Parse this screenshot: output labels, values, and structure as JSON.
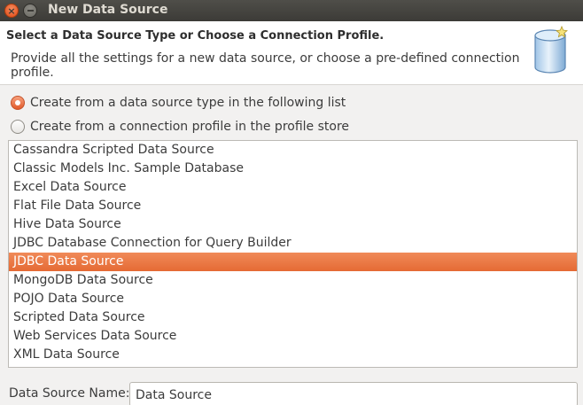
{
  "window": {
    "title": "New Data Source"
  },
  "banner": {
    "heading": "Select a Data Source Type or Choose a Connection Profile.",
    "description": "Provide all the settings for a new data source, or choose a pre-defined connection profile."
  },
  "options": [
    {
      "label": "Create from a data source type in the following list",
      "checked": true
    },
    {
      "label": "Create from a connection profile in the profile store",
      "checked": false
    }
  ],
  "data_source_types": [
    "Cassandra Scripted Data Source",
    "Classic Models Inc. Sample Database",
    "Excel Data Source",
    "Flat File Data Source",
    "Hive Data Source",
    "JDBC Database Connection for Query Builder",
    "JDBC Data Source",
    "MongoDB Data Source",
    "POJO Data Source",
    "Scripted Data Source",
    "Web Services Data Source",
    "XML Data Source"
  ],
  "selected_type": "JDBC Data Source",
  "name_field": {
    "label": "Data Source Name:",
    "value": "Data Source"
  },
  "colors": {
    "accent": "#e5622b",
    "titlebar": "#3c3b37",
    "selection": "#ea7643"
  },
  "icons": {
    "close": "close-icon",
    "minimize": "minimize-icon",
    "banner": "database-icon"
  }
}
